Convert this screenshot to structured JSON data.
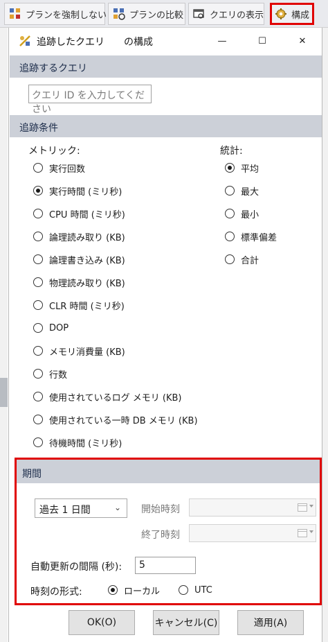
{
  "toolbar": {
    "items": [
      {
        "label": "プランを強制しない",
        "icon": "unforce-plan-icon"
      },
      {
        "label": "プランの比較",
        "icon": "compare-plans-icon"
      },
      {
        "label": "クエリの表示",
        "icon": "view-query-icon"
      },
      {
        "label": "構成",
        "icon": "configure-icon",
        "highlighted": true
      }
    ]
  },
  "dialog": {
    "title": "追跡したクエリ",
    "title_suffix": "の構成",
    "minimize": "—",
    "maximize": "☐",
    "close": "✕",
    "query_section": {
      "header": "追跡するクエリ",
      "input_placeholder": "クエリ ID を入力してください"
    },
    "criteria_section": {
      "header": "追跡条件",
      "metric_label": "メトリック:",
      "stat_label": "統計:",
      "metrics": [
        {
          "label": "実行回数",
          "selected": false
        },
        {
          "label": "実行時間 (ミリ秒)",
          "selected": true
        },
        {
          "label": "CPU 時間 (ミリ秒)",
          "selected": false
        },
        {
          "label": "論理読み取り (KB)",
          "selected": false
        },
        {
          "label": "論理書き込み (KB)",
          "selected": false
        },
        {
          "label": "物理読み取り (KB)",
          "selected": false
        },
        {
          "label": "CLR 時間 (ミリ秒)",
          "selected": false
        },
        {
          "label": "DOP",
          "selected": false
        },
        {
          "label": "メモリ消費量 (KB)",
          "selected": false
        },
        {
          "label": "行数",
          "selected": false
        },
        {
          "label": "使用されているログ メモリ (KB)",
          "selected": false
        },
        {
          "label": "使用されている一時 DB メモリ (KB)",
          "selected": false
        },
        {
          "label": "待機時間 (ミリ秒)",
          "selected": false
        }
      ],
      "stats": [
        {
          "label": "平均",
          "selected": true
        },
        {
          "label": "最大",
          "selected": false
        },
        {
          "label": "最小",
          "selected": false
        },
        {
          "label": "標準偏差",
          "selected": false
        },
        {
          "label": "合計",
          "selected": false
        }
      ]
    },
    "period_section": {
      "header": "期間",
      "range_value": "過去 1 日間",
      "start_label": "開始時刻",
      "end_label": "終了時刻",
      "refresh_label": "自動更新の間隔 (秒):",
      "refresh_value": "5",
      "time_format_label": "時刻の形式:",
      "time_formats": [
        {
          "label": "ローカル",
          "selected": true
        },
        {
          "label": "UTC",
          "selected": false
        }
      ]
    },
    "buttons": {
      "ok": "OK(O)",
      "cancel": "キャンセル(C)",
      "apply": "適用(A)"
    }
  },
  "colors": {
    "section_header": "#ccd0d8",
    "highlight_border": "#e00000"
  }
}
